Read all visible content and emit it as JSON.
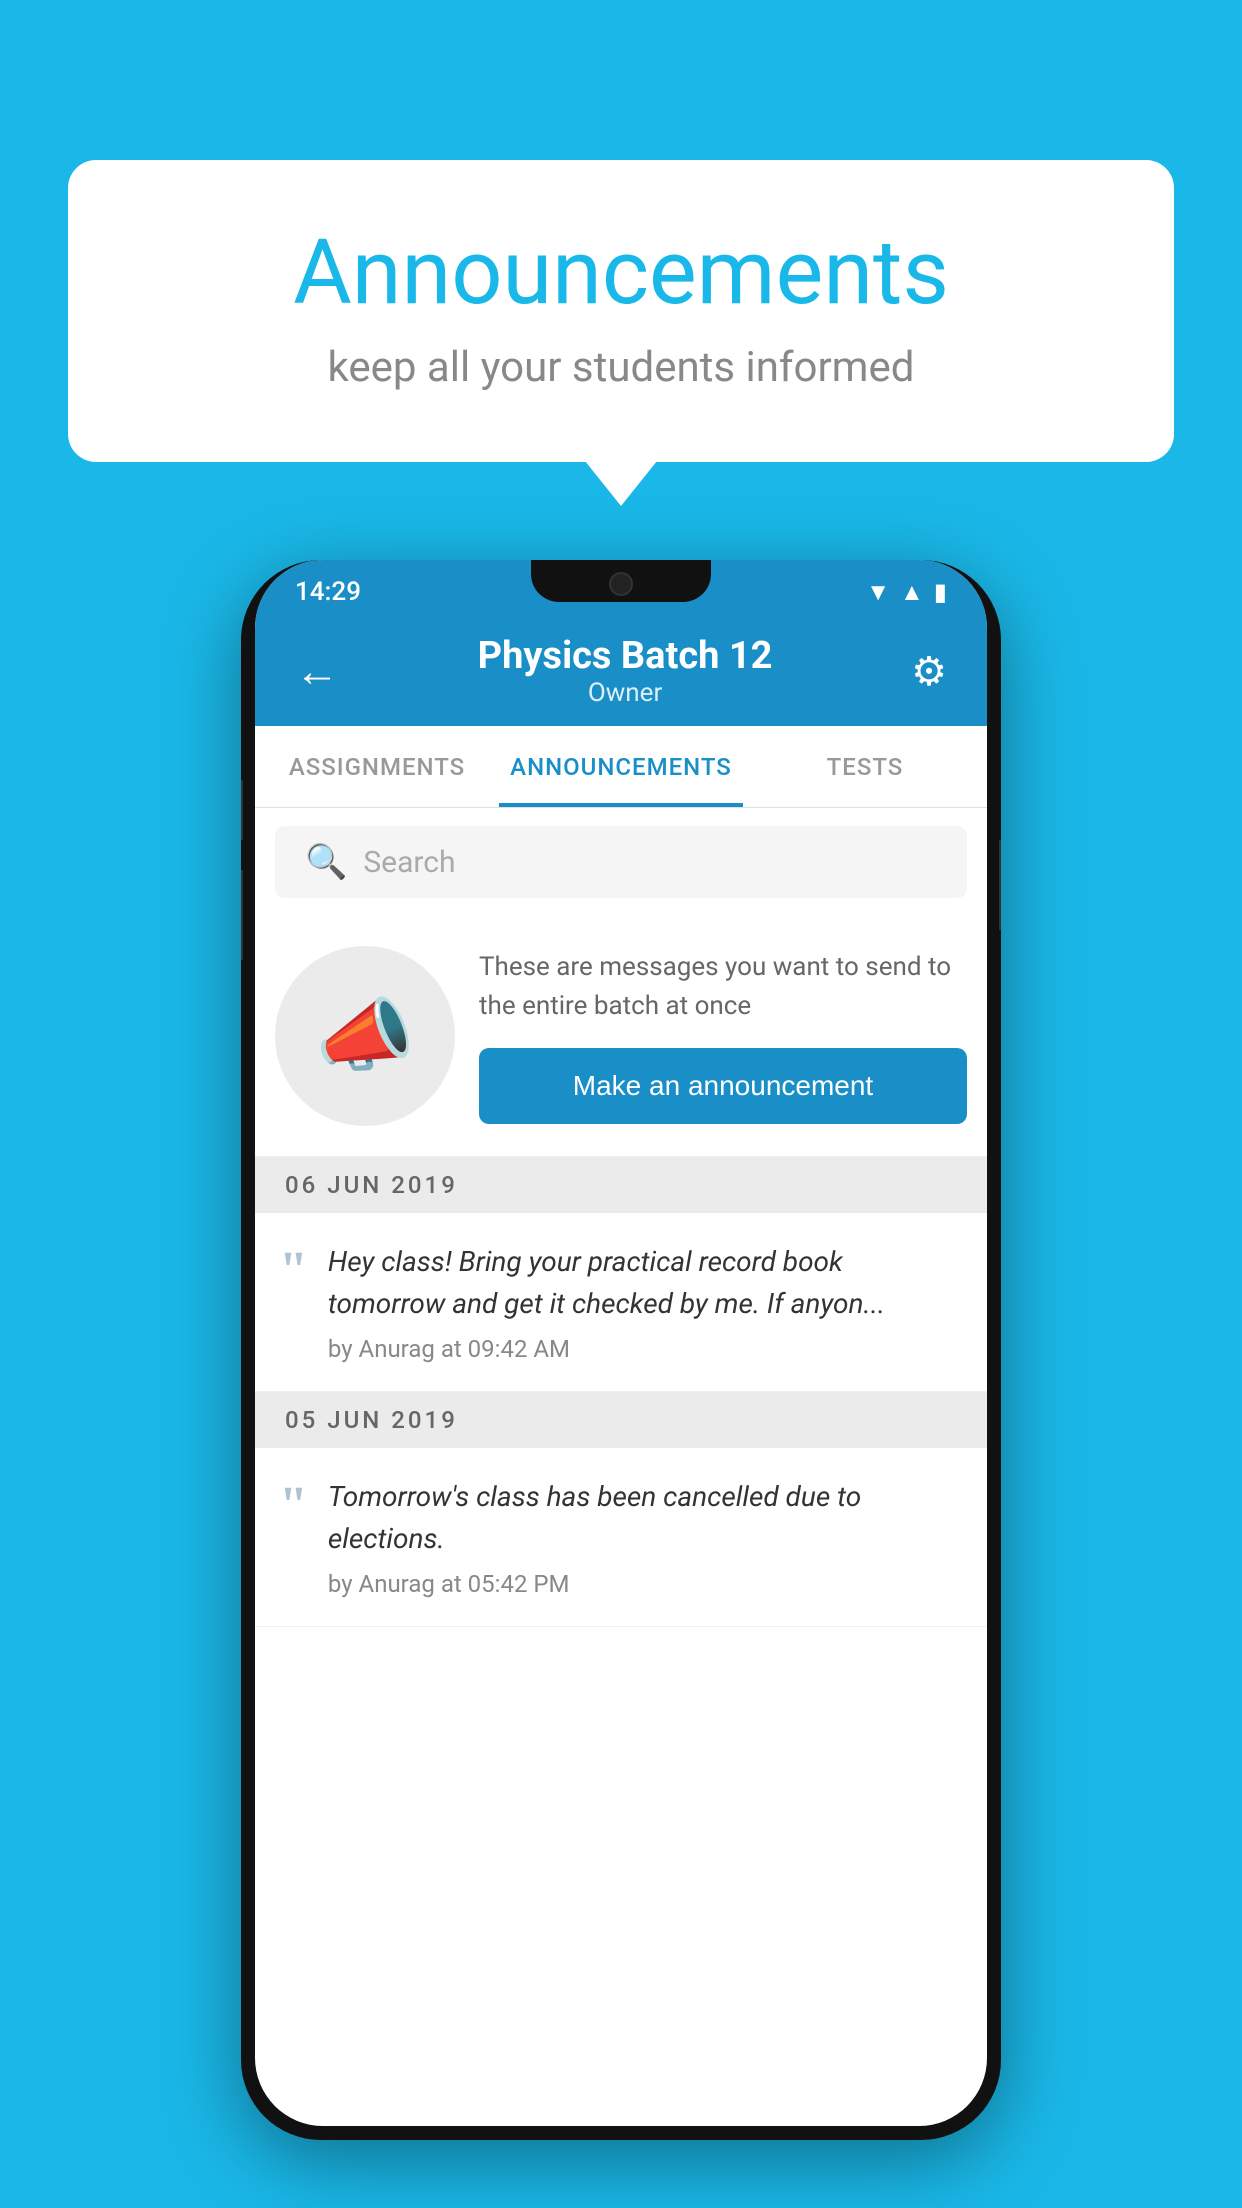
{
  "background_color": "#1ab8e8",
  "speech_bubble": {
    "title": "Announcements",
    "subtitle": "keep all your students informed"
  },
  "phone": {
    "status_bar": {
      "time": "14:29"
    },
    "app_bar": {
      "title": "Physics Batch 12",
      "subtitle": "Owner",
      "back_label": "←",
      "settings_label": "⚙"
    },
    "tabs": [
      {
        "label": "ASSIGNMENTS",
        "active": false
      },
      {
        "label": "ANNOUNCEMENTS",
        "active": true
      },
      {
        "label": "TESTS",
        "active": false
      }
    ],
    "search": {
      "placeholder": "Search"
    },
    "announce_prompt": {
      "description": "These are messages you want to send to the entire batch at once",
      "button_label": "Make an announcement"
    },
    "messages": [
      {
        "date": "06  JUN  2019",
        "text": "Hey class! Bring your practical record book tomorrow and get it checked by me. If anyon...",
        "author": "by Anurag at 09:42 AM"
      },
      {
        "date": "05  JUN  2019",
        "text": "Tomorrow's class has been cancelled due to elections.",
        "author": "by Anurag at 05:42 PM"
      }
    ]
  }
}
